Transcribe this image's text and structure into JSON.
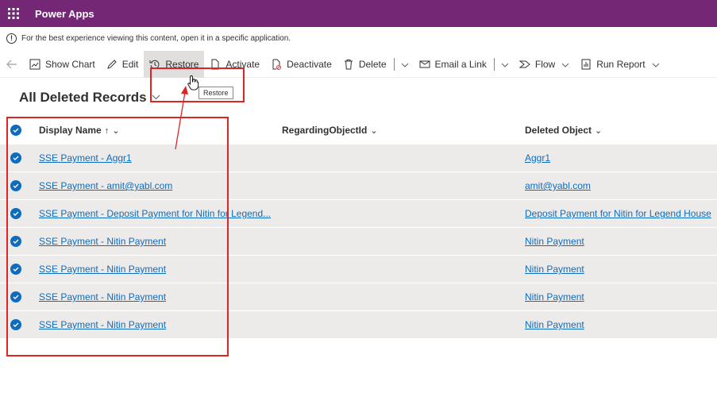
{
  "appbar": {
    "app_name": "Power Apps",
    "waffle_icon": "waffle-icon"
  },
  "infobar": {
    "icon": "info-icon",
    "icon_glyph": "!",
    "text": "For the best experience viewing this content, open it in a specific application."
  },
  "commandbar": {
    "back_icon": "back-arrow-icon",
    "show_chart": "Show Chart",
    "edit": "Edit",
    "restore": "Restore",
    "activate": "Activate",
    "deactivate": "Deactivate",
    "delete": "Delete",
    "email_link": "Email a Link",
    "flow": "Flow",
    "run_report": "Run Report"
  },
  "tooltip": {
    "text": "Restore"
  },
  "view": {
    "title": "All Deleted Records"
  },
  "grid": {
    "columns": {
      "display_name": "Display Name",
      "sort_indicator": "↑",
      "regarding": "RegardingObjectId",
      "deleted_object": "Deleted Object"
    },
    "rows": [
      {
        "display_name": "SSE Payment - Aggr1",
        "regarding": "",
        "deleted_object": "Aggr1",
        "selected": true
      },
      {
        "display_name": "SSE Payment - amit@yabl.com",
        "regarding": "",
        "deleted_object": "amit@yabl.com",
        "selected": true
      },
      {
        "display_name": "SSE Payment - Deposit Payment for Nitin for Legend...",
        "regarding": "",
        "deleted_object": "Deposit Payment for Nitin for Legend House",
        "selected": true
      },
      {
        "display_name": "SSE Payment - Nitin Payment",
        "regarding": "",
        "deleted_object": "Nitin Payment",
        "selected": true
      },
      {
        "display_name": "SSE Payment - Nitin Payment",
        "regarding": "",
        "deleted_object": "Nitin Payment",
        "selected": true
      },
      {
        "display_name": "SSE Payment - Nitin Payment",
        "regarding": "",
        "deleted_object": "Nitin Payment",
        "selected": true
      },
      {
        "display_name": "SSE Payment - Nitin Payment",
        "regarding": "",
        "deleted_object": "Nitin Payment",
        "selected": true
      }
    ]
  },
  "colors": {
    "appbar": "#742774",
    "link": "#0f6cbd",
    "highlight": "#e02424",
    "row_bg": "#edebe9"
  }
}
